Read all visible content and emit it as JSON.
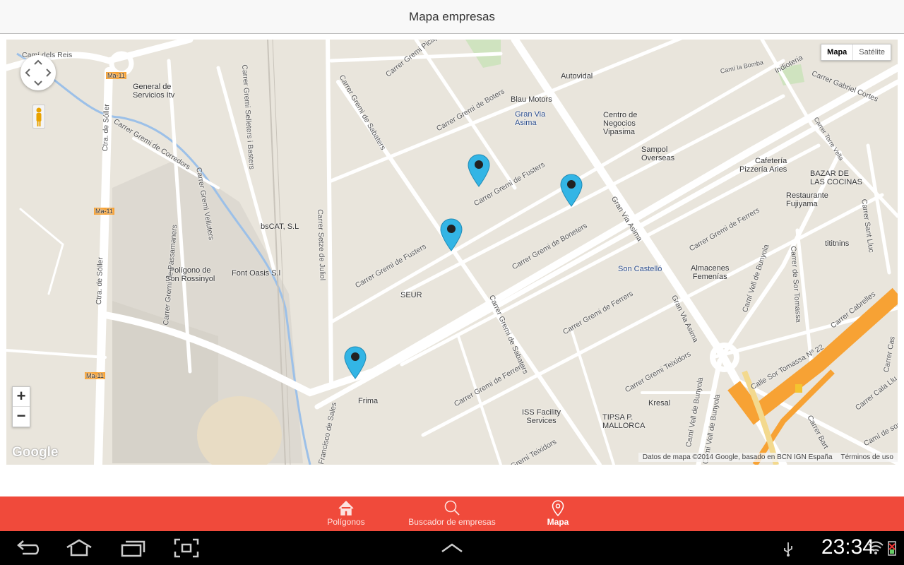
{
  "header": {
    "title": "Mapa empresas"
  },
  "map": {
    "type_buttons": {
      "map": "Mapa",
      "satellite": "Satélite"
    },
    "zoom": {
      "in": "+",
      "out": "−"
    },
    "logo": "Google",
    "attribution": "Datos de mapa ©2014 Google, basado en BCN IGN España",
    "terms": "Términos de uso",
    "places": [
      {
        "name": "Autovidal"
      },
      {
        "name": "Blau Motors"
      },
      {
        "name": "Gran Via\nAsima"
      },
      {
        "name": "Centro de\nNegocios\nVipasima"
      },
      {
        "name": "Sampol\nOverseas"
      },
      {
        "name": "Cafetería\nPizzería Aries"
      },
      {
        "name": "BAZAR DE\nLAS COCINAS"
      },
      {
        "name": "Restaurante\nFujiyama"
      },
      {
        "name": "tititnins"
      },
      {
        "name": "General de\nServicios Itv"
      },
      {
        "name": "bsCAT, S.L"
      },
      {
        "name": "Polígono de\nSon Rossinyol"
      },
      {
        "name": "Font Oasis S.l"
      },
      {
        "name": "SEUR"
      },
      {
        "name": "Son Castelló"
      },
      {
        "name": "Almacenes\nFemenías"
      },
      {
        "name": "Frima"
      },
      {
        "name": "ISS Facility\nServices"
      },
      {
        "name": "TIPSA P.\nMALLORCA"
      },
      {
        "name": "Kresal"
      }
    ],
    "roads": [
      "Camí dels Reis",
      "Ma-11",
      "Ma-11",
      "Ma-11",
      "Ctra. de Sóller",
      "Ctra. de Sóller",
      "Carrer Gremi de Corredors",
      "Carrer Gremi Selleters i Basters",
      "Carrer Gremi Velluters",
      "Carrer Gremi de Passamaners",
      "Carrer Setze de Juliol",
      "Carrer Gremi Picapedrers",
      "Carrer Gremi de Sabaters",
      "Carrer Gremi de Boters",
      "Carrer Gremi de Fusters",
      "Carrer Gremi de Fusters",
      "Carrer Gremi de Boneters",
      "Gran Via Asima",
      "Gran Via Asima",
      "Carrer Gremi de Ferrers",
      "Carrer Gremi de Ferrers",
      "Carrer Gremi de Ferrers",
      "Carrer Gremi de Sabaters",
      "Carrer Gremi Teixidors",
      "Gremi Teixidors",
      "Camí Vell de Bunyola",
      "Camí Vell de Bunyola",
      "Camí Vell de Bunyola",
      "Carrer de Sor Tomassa",
      "Carrer Sant Lluc",
      "Carrer Gabriel Cortes",
      "Indioteria",
      "Camí la Bomba",
      "Carrer Torre Vella",
      "Carrer Cabrelles",
      "Calle Sor Tomassa Nº 22",
      "Carrer Cala Llu",
      "Camí de son",
      "Carrer Bart",
      "Francisco de Sales",
      "Carrer Cas"
    ]
  },
  "tabs": [
    {
      "label": "Polígonos",
      "icon": "home-icon",
      "active": false
    },
    {
      "label": "Buscador de empresas",
      "icon": "search-icon",
      "active": false
    },
    {
      "label": "Mapa",
      "icon": "map-pin-icon",
      "active": true
    }
  ],
  "system": {
    "clock": "23:34"
  },
  "colors": {
    "accent": "#f04a3b",
    "pin": "#33b5e5",
    "map_bg": "#e9e5dc"
  }
}
